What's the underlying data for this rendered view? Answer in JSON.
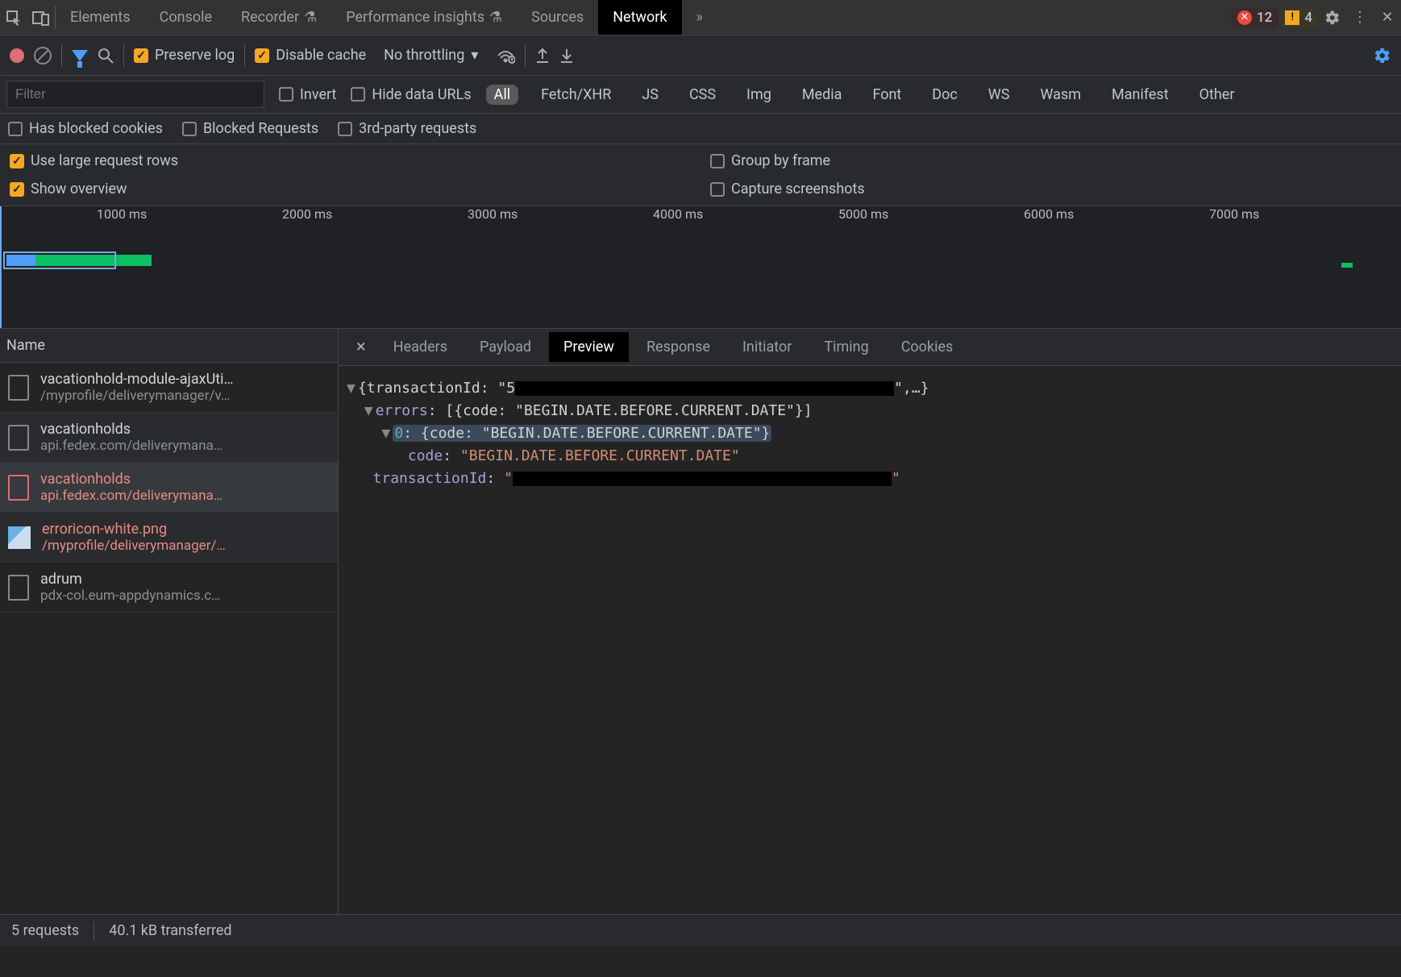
{
  "top": {
    "tabs": [
      "Elements",
      "Console",
      "Recorder",
      "Performance insights",
      "Sources",
      "Network"
    ],
    "activeTab": "Network",
    "errors": "12",
    "warnings": "4"
  },
  "toolbar": {
    "preserve_log": "Preserve log",
    "disable_cache": "Disable cache",
    "throttling": "No throttling"
  },
  "filter": {
    "placeholder": "Filter",
    "invert": "Invert",
    "hide_data": "Hide data URLs",
    "types": [
      "All",
      "Fetch/XHR",
      "JS",
      "CSS",
      "Img",
      "Media",
      "Font",
      "Doc",
      "WS",
      "Wasm",
      "Manifest",
      "Other"
    ],
    "activeType": "All",
    "has_blocked": "Has blocked cookies",
    "blocked_req": "Blocked Requests",
    "third_party": "3rd-party requests"
  },
  "options": {
    "large_rows": "Use large request rows",
    "show_overview": "Show overview",
    "group_frame": "Group by frame",
    "capture_ss": "Capture screenshots"
  },
  "timeline": {
    "ticks": [
      "1000 ms",
      "2000 ms",
      "3000 ms",
      "4000 ms",
      "5000 ms",
      "6000 ms",
      "7000 ms"
    ]
  },
  "requests": {
    "header": "Name",
    "rows": [
      {
        "name": "vacationhold-module-ajaxUti…",
        "path": "/myprofile/deliverymanager/v…",
        "icon": "doc",
        "error": false
      },
      {
        "name": "vacationholds",
        "path": "api.fedex.com/deliverymana…",
        "icon": "doc",
        "error": false
      },
      {
        "name": "vacationholds",
        "path": "api.fedex.com/deliverymana…",
        "icon": "doc",
        "error": true,
        "selected": true
      },
      {
        "name": "erroricon-white.png",
        "path": "/myprofile/deliverymanager/…",
        "icon": "img",
        "error": true
      },
      {
        "name": "adrum",
        "path": "pdx-col.eum-appdynamics.c…",
        "icon": "doc",
        "error": false
      }
    ]
  },
  "detail": {
    "tabs": [
      "Headers",
      "Payload",
      "Preview",
      "Response",
      "Initiator",
      "Timing",
      "Cookies"
    ],
    "activeTab": "Preview",
    "json": {
      "line1_pre": "{transactionId: \"5",
      "line1_post": "\",…}",
      "errors_label": "errors",
      "errors_val": "[{code: \"BEGIN.DATE.BEFORE.CURRENT.DATE\"}]",
      "idx0": "0",
      "idx0_val": "{code: \"BEGIN.DATE.BEFORE.CURRENT.DATE\"}",
      "code_label": "code",
      "code_val": "\"BEGIN.DATE.BEFORE.CURRENT.DATE\"",
      "tid_label": "transactionId",
      "tid_q1": "\"",
      "tid_q2": "\""
    }
  },
  "status": {
    "requests": "5 requests",
    "transferred": "40.1 kB transferred"
  }
}
